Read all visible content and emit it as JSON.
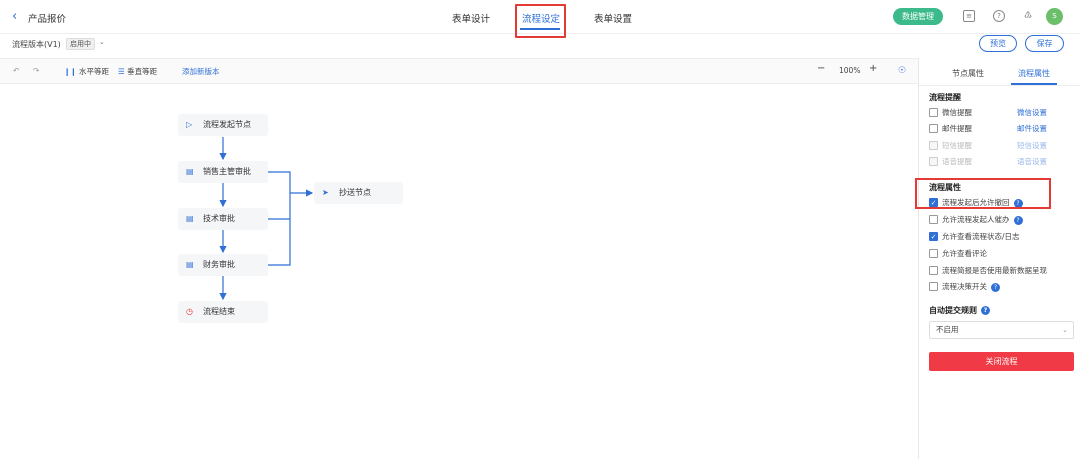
{
  "header": {
    "back_icon": "chevron-left-icon",
    "title": "产品报价",
    "tabs": [
      "表单设计",
      "流程设定",
      "表单设置"
    ],
    "data_mgmt_label": "数据管理",
    "avatar_text": "S"
  },
  "version_bar": {
    "label": "流程版本(V1)",
    "status": "启用中",
    "preview_label": "预览",
    "save_label": "保存"
  },
  "toolbar": {
    "horizontal_sort": "水平等距",
    "vertical_sort": "垂直等距",
    "add_version": "添加新版本",
    "zoom": "100%"
  },
  "nodes": {
    "start": "流程发起节点",
    "sales": "销售主管审批",
    "tech": "技术审批",
    "finance": "财务审批",
    "end": "流程结束",
    "cc": "抄送节点"
  },
  "panel": {
    "tabs": [
      "节点属性",
      "流程属性"
    ],
    "reminder_title": "流程提醒",
    "reminders": [
      {
        "label": "微信提醒",
        "link": "微信设置",
        "checked": false,
        "disabled": false
      },
      {
        "label": "邮件提醒",
        "link": "邮件设置",
        "checked": false,
        "disabled": false
      },
      {
        "label": "短信提醒",
        "link": "短信设置",
        "checked": false,
        "disabled": true
      },
      {
        "label": "语音提醒",
        "link": "语音设置",
        "checked": false,
        "disabled": true
      }
    ],
    "props_title": "流程属性",
    "props": [
      {
        "label": "流程发起后允许撤回",
        "checked": true,
        "help": true
      },
      {
        "label": "允许流程发起人催办",
        "checked": false,
        "help": true
      },
      {
        "label": "允许查看流程状态/日志",
        "checked": true,
        "help": false
      },
      {
        "label": "允许查看评论",
        "checked": false,
        "help": false
      },
      {
        "label": "流程简报是否使用最新数据呈现",
        "checked": false,
        "help": false
      },
      {
        "label": "流程决策开关",
        "checked": false,
        "help": true
      }
    ],
    "auto_title": "自动提交规则",
    "auto_value": "不启用",
    "close_label": "关闭流程"
  },
  "colors": {
    "accent": "#2f6fd6",
    "danger": "#f03a46",
    "green": "#3dba8c"
  }
}
